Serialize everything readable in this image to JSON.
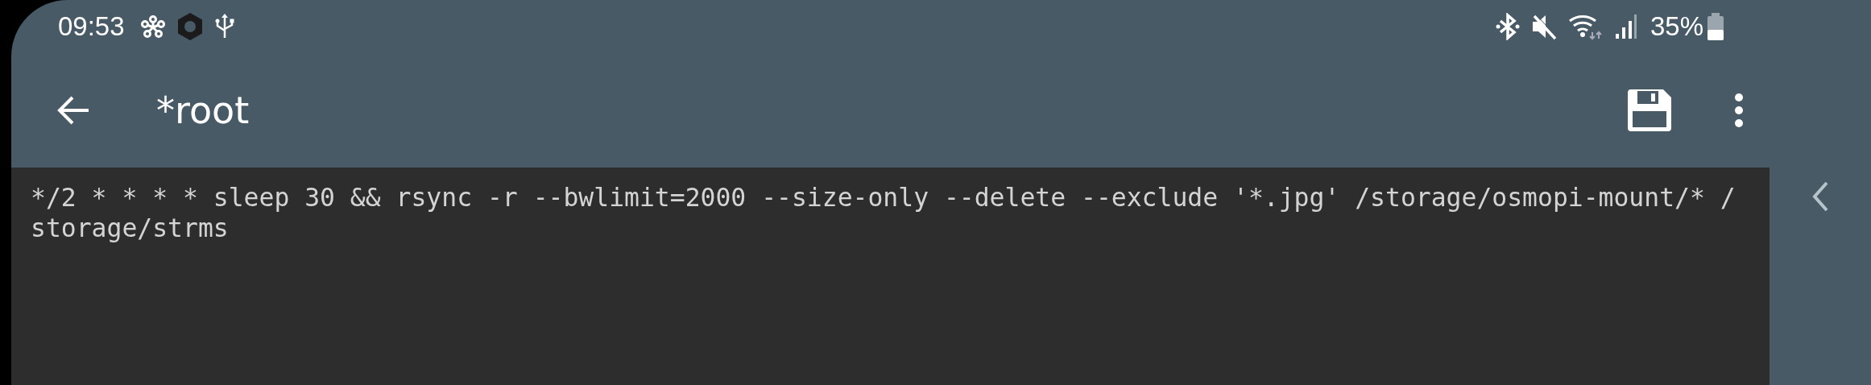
{
  "status_bar": {
    "time": "09:53",
    "battery": "35%"
  },
  "toolbar": {
    "title": "*root"
  },
  "editor": {
    "text": "*/2 * * * * sleep 30 && rsync -r --bwlimit=2000 --size-only --delete --exclude '*.jpg' /storage/osmopi-mount/* /storage/strms"
  }
}
